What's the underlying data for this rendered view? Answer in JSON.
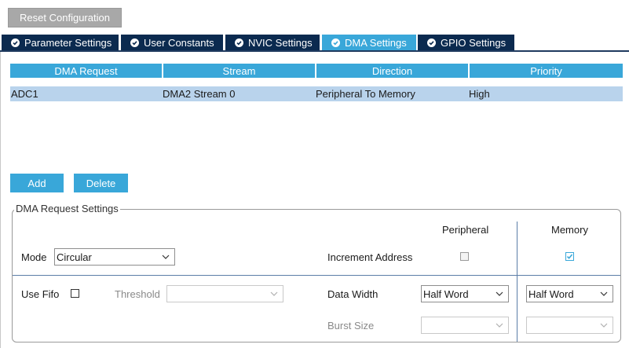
{
  "toolbar": {
    "reset_label": "Reset Configuration"
  },
  "tabs": [
    {
      "label": "Parameter Settings",
      "active": false,
      "icon": "check-circle-icon"
    },
    {
      "label": "User Constants",
      "active": false,
      "icon": "check-circle-icon"
    },
    {
      "label": "NVIC Settings",
      "active": false,
      "icon": "check-circle-icon"
    },
    {
      "label": "DMA Settings",
      "active": true,
      "icon": "check-circle-icon"
    },
    {
      "label": "GPIO Settings",
      "active": false,
      "icon": "check-circle-icon"
    }
  ],
  "table": {
    "headers": [
      "DMA Request",
      "Stream",
      "Direction",
      "Priority"
    ],
    "rows": [
      [
        "ADC1",
        "DMA2 Stream 0",
        "Peripheral To Memory",
        "High"
      ]
    ]
  },
  "actions": {
    "add_label": "Add",
    "delete_label": "Delete"
  },
  "settings": {
    "legend": "DMA Request Settings",
    "col_peripheral": "Peripheral",
    "col_memory": "Memory",
    "mode_label": "Mode",
    "mode_value": "Circular",
    "increment_label": "Increment Address",
    "increment_peripheral": false,
    "increment_memory": true,
    "use_fifo_label": "Use Fifo",
    "use_fifo": false,
    "threshold_label": "Threshold",
    "threshold_value": "",
    "data_width_label": "Data Width",
    "data_width_peripheral": "Half Word",
    "data_width_memory": "Half Word",
    "burst_size_label": "Burst Size",
    "burst_peripheral": "",
    "burst_memory": ""
  },
  "colors": {
    "accent": "#39a7d9",
    "tab_bg": "#0b2a4f",
    "row_selected": "#b9d3ec",
    "button_grey": "#a8a8a8"
  }
}
